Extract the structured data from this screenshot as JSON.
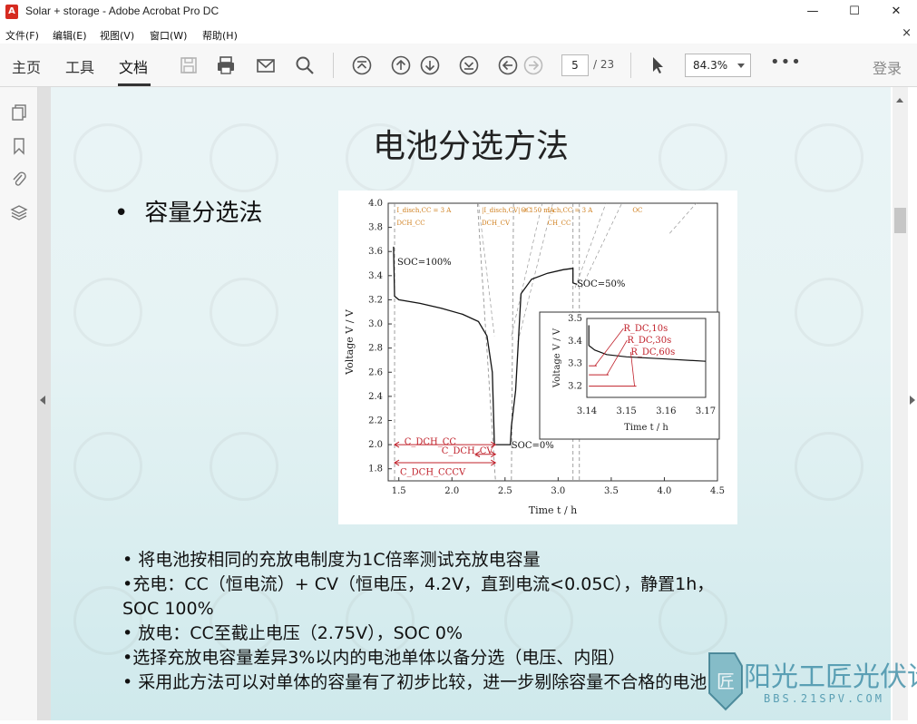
{
  "window": {
    "title": "Solar + storage - Adobe Acrobat Pro DC",
    "minimize": "—",
    "maximize": "☐",
    "close": "✕"
  },
  "menu": {
    "items": [
      "文件(F)",
      "编辑(E)",
      "视图(V)",
      "窗口(W)",
      "帮助(H)"
    ],
    "close": "×"
  },
  "toolbar": {
    "tabs": [
      "主页",
      "工具",
      "文档"
    ],
    "active_tab": "文档",
    "page_current": "5",
    "page_total": "/ 23",
    "zoom": "84.3%",
    "more": "•••",
    "login": "登录",
    "icons": [
      "save-icon",
      "print-icon",
      "email-icon",
      "search-icon",
      "first-page-icon",
      "prev-page-icon",
      "next-page-icon",
      "last-page-icon",
      "back-icon",
      "forward-icon",
      "select-cursor-icon"
    ]
  },
  "slide": {
    "title": "电池分选方法",
    "heading_bullet": "•",
    "heading": "容量分选法",
    "bullets": [
      "• 将电池按相同的充放电制度为1C倍率测试充放电容量",
      "•充电：CC（恒电流）+ CV（恒电压，4.2V，直到电流<0.05C），静置1h，",
      "SOC 100%",
      "• 放电：CC至截止电压（2.75V），SOC 0%",
      "•选择充放电容量差异3%以内的电池单体以备分选（电压、内阻）",
      "• 采用此方法可以对单体的容量有了初步比较，进一步剔除容量不合格的电池"
    ]
  },
  "chart_data": {
    "type": "line",
    "xlabel": "Time t / h",
    "ylabel": "Voltage V / V",
    "xlim": [
      1.4,
      4.5
    ],
    "ylim": [
      1.7,
      4.0
    ],
    "x_ticks": [
      "1.5",
      "2.0",
      "2.5",
      "3.0",
      "3.5",
      "4.0",
      "4.5"
    ],
    "y_ticks": [
      "1.8",
      "2.0",
      "2.2",
      "2.4",
      "2.6",
      "2.8",
      "3.0",
      "3.2",
      "3.4",
      "3.6",
      "3.8",
      "4.0"
    ],
    "phase_labels": [
      {
        "line1": "I_disch,CC = 3 A",
        "line2": "DCH_CC"
      },
      {
        "line1": "|I_disch,CV| < 150 mA",
        "line2": "DCH_CV"
      },
      {
        "line1": "OC",
        "line2": ""
      },
      {
        "line1": "I_ch,CC = 3 A",
        "line2": "CH_CC"
      },
      {
        "line1": "OC",
        "line2": ""
      }
    ],
    "annotations": [
      "SOC=100%",
      "SOC=50%",
      "SOC=0%"
    ],
    "capacity_labels": [
      "C_DCH_CC",
      "C_DCH_CV",
      "C_DCH_CCCV"
    ],
    "series": [
      {
        "x": [
          1.45,
          1.46,
          1.5,
          1.7,
          1.9,
          2.1,
          2.25,
          2.33,
          2.38,
          2.4,
          2.41,
          2.55,
          2.56,
          2.6,
          2.65,
          2.75,
          2.9,
          3.05,
          3.14,
          3.14,
          3.17,
          3.18
        ],
        "values": [
          3.64,
          3.23,
          3.2,
          3.17,
          3.13,
          3.08,
          3.02,
          2.9,
          2.6,
          2.0,
          2.0,
          2.0,
          2.15,
          2.45,
          3.25,
          3.37,
          3.42,
          3.45,
          3.46,
          3.34,
          3.33,
          3.33
        ]
      }
    ],
    "inset": {
      "xlabel": "Time t / h",
      "ylabel": "Voltage V / V",
      "xlim": [
        3.14,
        3.17
      ],
      "ylim": [
        3.15,
        3.5
      ],
      "x_ticks": [
        "3.14",
        "3.15",
        "3.16",
        "3.17"
      ],
      "y_ticks": [
        "3.2",
        "3.3",
        "3.4",
        "3.5"
      ],
      "labels": [
        "R_DC,10s",
        "R_DC,30s",
        "R_DC,60s"
      ],
      "series": [
        {
          "x": [
            3.1405,
            3.1405,
            3.142,
            3.145,
            3.15,
            3.16,
            3.17
          ],
          "values": [
            3.47,
            3.38,
            3.36,
            3.34,
            3.33,
            3.32,
            3.31
          ]
        }
      ]
    }
  },
  "watermark": {
    "logo_text": "阳光工匠光伏论坛",
    "url": "BBS.21SPV.COM"
  }
}
